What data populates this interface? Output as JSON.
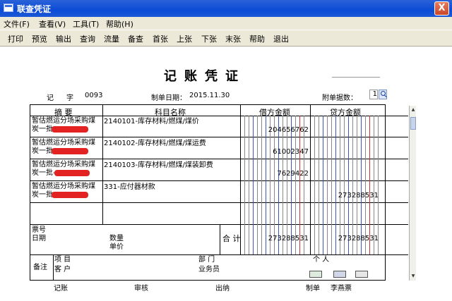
{
  "window": {
    "title": "联查凭证",
    "close_label": "X"
  },
  "menu": [
    "文件(F)",
    "查看(V)",
    "工具(T)",
    "帮助(H)"
  ],
  "toolbar": [
    "打印",
    "预览",
    "输出",
    "查询",
    "流量",
    "备查",
    "首张",
    "上张",
    "下张",
    "末张",
    "帮助",
    "退出"
  ],
  "voucher": {
    "title": "记账凭证",
    "type": "记",
    "type_label": "字",
    "number": "0093",
    "date_label": "制单日期：",
    "date": "2015.11.30",
    "attach_label": "附单据数：",
    "attach_count": "1"
  },
  "headers": {
    "summary": "摘 要",
    "subject": "科目名称",
    "debit": "借方金额",
    "credit": "贷方金额"
  },
  "rows": [
    {
      "summary_1": "暂估燃运分场采购煤",
      "summary_2": "炭一批",
      "subject": "2140101-库存材料/燃煤/煤价",
      "debit": "204656762",
      "credit": ""
    },
    {
      "summary_1": "暂估燃运分场采购煤",
      "summary_2": "炭一批",
      "subject": "2140102-库存材料/燃煤/煤运费",
      "debit": "61002347",
      "credit": ""
    },
    {
      "summary_1": "暂估燃运分场采购煤",
      "summary_2": "炭一批-",
      "subject": "2140103-库存材料/燃煤/煤装卸费",
      "debit": "7629422",
      "credit": ""
    },
    {
      "summary_1": "暂估燃运分场采购煤",
      "summary_2": "炭一批",
      "subject": "331-应付器材款",
      "debit": "",
      "credit": "273288531"
    }
  ],
  "footer": {
    "ticket_no": "票号",
    "date": "日期",
    "quantity": "数量",
    "unit_price": "单价",
    "total_label": "合 计",
    "total_debit": "273288531",
    "total_credit": "273288531",
    "remarks": "备注",
    "project": "项 目",
    "department": "部 门",
    "individual": "个 人",
    "customer": "客 户",
    "salesperson": "业务员"
  },
  "signatures": {
    "bookkeeping": "记账",
    "review": "审核",
    "cashier": "出纳",
    "preparer_label": "制单",
    "preparer": "李燕票"
  },
  "icons": [
    "calculator-icon",
    "card-icon",
    "tools-icon"
  ]
}
